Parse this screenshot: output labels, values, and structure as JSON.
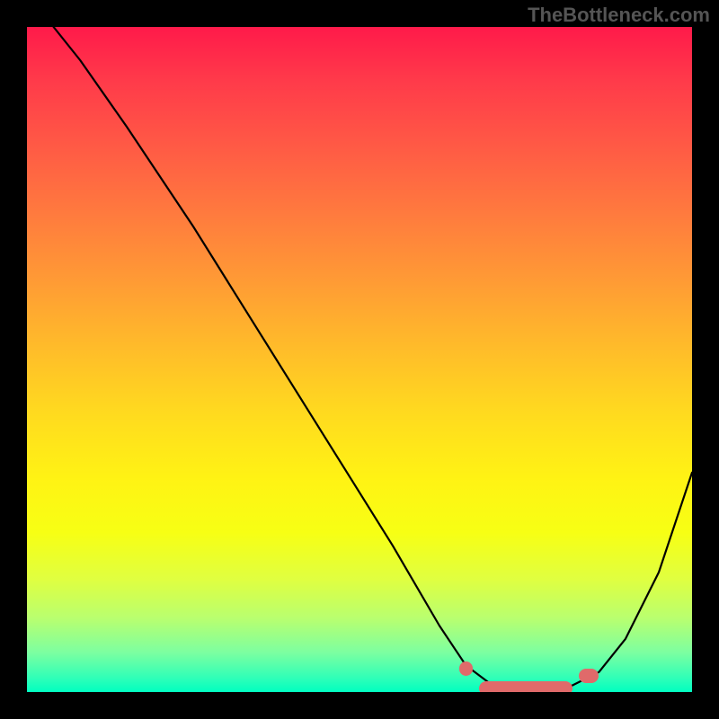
{
  "watermark": "TheBottleneck.com",
  "chart_data": {
    "type": "line",
    "title": "",
    "xlabel": "",
    "ylabel": "",
    "xlim": [
      0,
      100
    ],
    "ylim": [
      0,
      100
    ],
    "grid": false,
    "series": [
      {
        "name": "curve",
        "color": "#000000",
        "x": [
          4,
          8,
          15,
          25,
          35,
          45,
          55,
          62,
          66,
          70,
          74,
          78,
          82,
          86,
          90,
          95,
          100
        ],
        "y": [
          100,
          95,
          85,
          70,
          54,
          38,
          22,
          10,
          4,
          1,
          0.5,
          0.5,
          1,
          3,
          8,
          18,
          33
        ]
      }
    ],
    "markers": [
      {
        "name": "left-tick-segment",
        "x_start": 65,
        "x_end": 67,
        "y": 3.5,
        "color": "#e06a6a"
      },
      {
        "name": "flat-segment",
        "x_start": 68,
        "x_end": 82,
        "y": 0.5,
        "color": "#e06a6a"
      },
      {
        "name": "right-tick-segment",
        "x_start": 83,
        "x_end": 86,
        "y": 2.5,
        "color": "#e06a6a"
      }
    ],
    "gradient_colors": {
      "top": "#ff1a4a",
      "mid": "#ffe020",
      "bottom": "#00ffc0"
    }
  }
}
